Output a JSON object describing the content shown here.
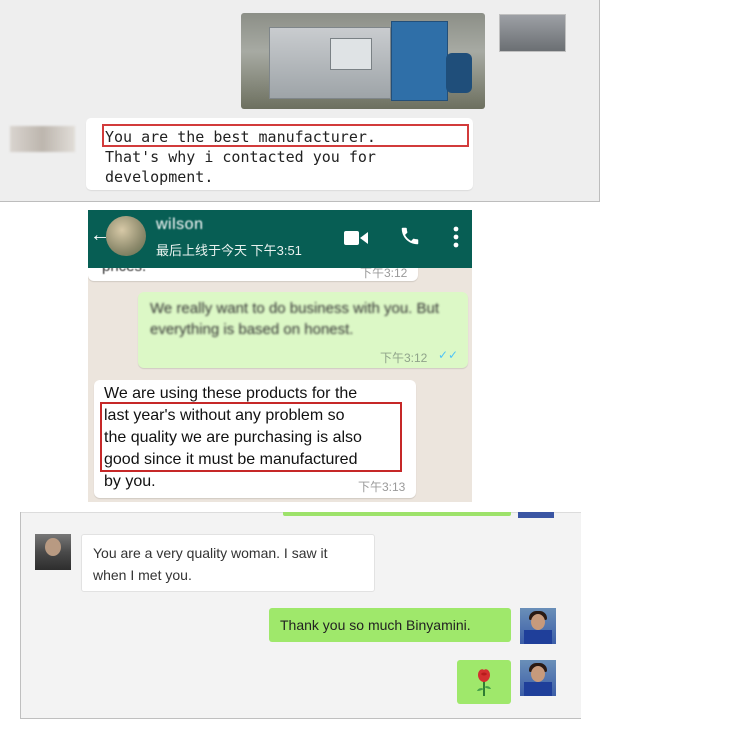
{
  "panel1": {
    "message_lines": [
      "You are the best manufacturer.",
      "That's why i contacted you for",
      "development."
    ]
  },
  "whatsapp": {
    "contact_name": "wilson",
    "last_seen": "最后上线于今天 下午3:51",
    "messages": [
      {
        "text": "prices.",
        "time": "下午3:12"
      },
      {
        "text": "We really want to do business with you. But everything is based on honest.",
        "time": "下午3:12"
      },
      {
        "lines": [
          "We are using these products for the",
          "last year's without any problem so",
          "the quality we are purchasing is also",
          "good since it must be manufactured",
          "by you."
        ],
        "time": "下午3:13"
      }
    ],
    "header_color": "#075e54",
    "outgoing_color": "#dcf8c6"
  },
  "panel3": {
    "incoming_lines": [
      "You are a very quality woman. I saw it",
      "when I met you."
    ],
    "outgoing_text": "Thank you so much Binyamini.",
    "outgoing_color": "#9fe86b"
  },
  "highlight_color": "#d23b3b"
}
